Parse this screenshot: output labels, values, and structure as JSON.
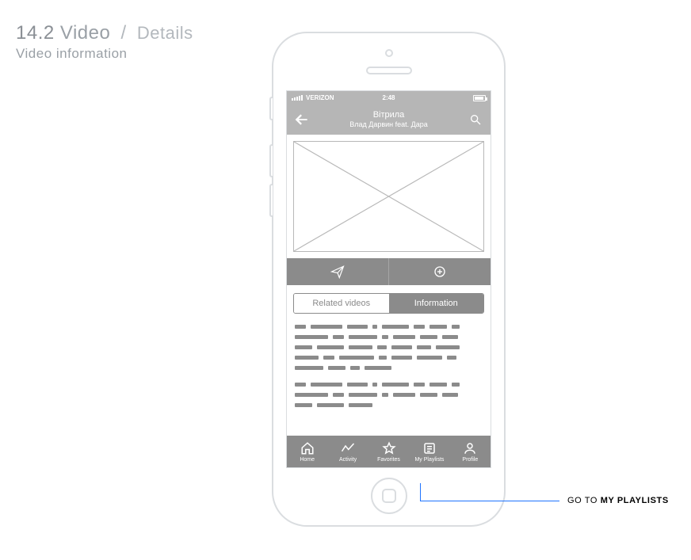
{
  "page": {
    "section_number": "14.2",
    "section_title": "Video",
    "section_sub": "Details",
    "subtitle": "Video information"
  },
  "status": {
    "carrier": "VERIZON",
    "time": "2:48"
  },
  "header": {
    "title": "Вітрила",
    "artist": "Влад Дарвин feat. Дара"
  },
  "actions": {
    "share": "share",
    "add": "add"
  },
  "tabs": {
    "related": {
      "label": "Related videos",
      "active": false
    },
    "information": {
      "label": "Information",
      "active": true
    }
  },
  "tabbar": {
    "home": "Home",
    "activity": "Activity",
    "favorites": "Favorites",
    "myplaylists": "My Playlists",
    "profile": "Profile"
  },
  "callout": {
    "prefix": "GO TO ",
    "target": "MY PLAYLISTS"
  }
}
